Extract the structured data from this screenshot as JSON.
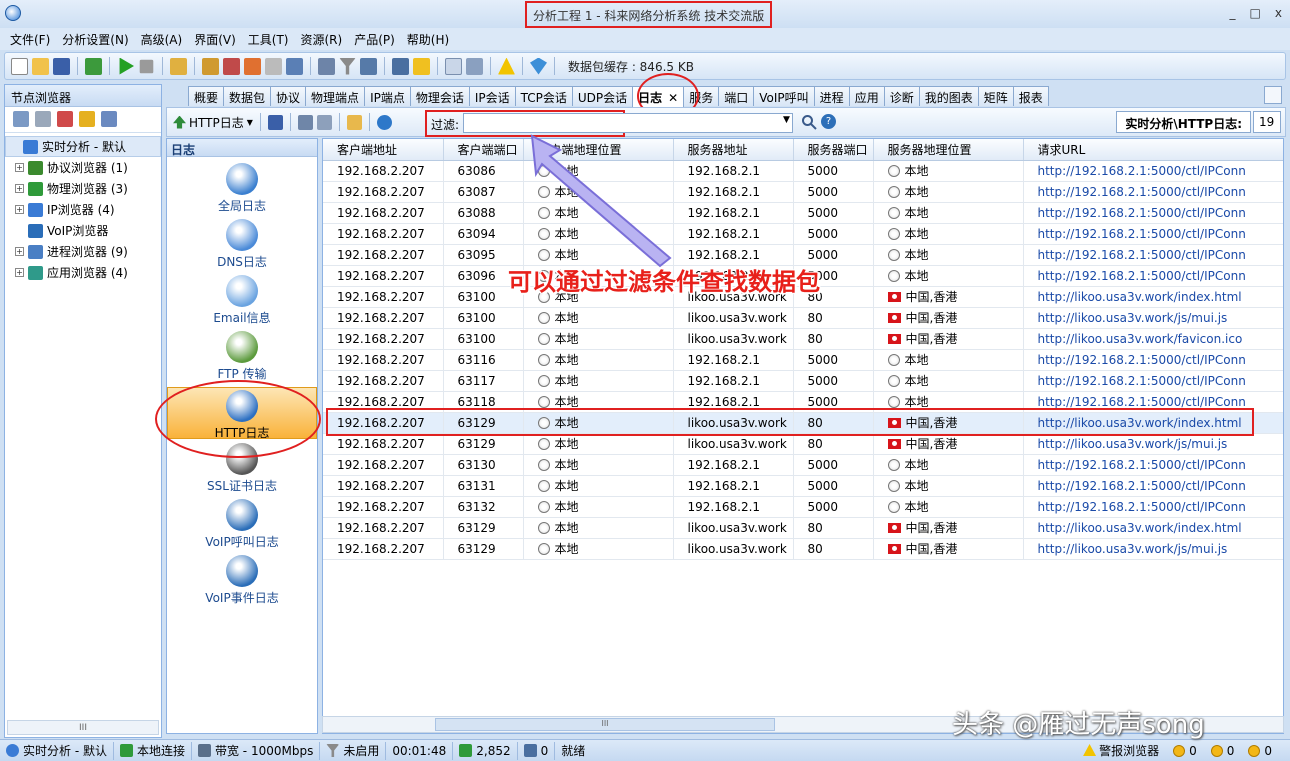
{
  "window": {
    "title": "分析工程 1 - 科来网络分析系统 技术交流版",
    "min": "_",
    "max": "□",
    "close": "x"
  },
  "menu": [
    "文件(F)",
    "分析设置(N)",
    "高级(A)",
    "界面(V)",
    "工具(T)",
    "资源(R)",
    "产品(P)",
    "帮助(H)"
  ],
  "toolbar": {
    "cache_label": "数据包缓存 : 846.5 KB"
  },
  "left_panel": {
    "title": "节点浏览器",
    "tree": [
      {
        "label": "实时分析 - 默认",
        "expander": "",
        "color": "#3a7bd5",
        "selected": true
      },
      {
        "label": "协议浏览器 (1)",
        "expander": "+",
        "color": "#3b8a2e"
      },
      {
        "label": "物理浏览器 (3)",
        "expander": "+",
        "color": "#2f9a3a"
      },
      {
        "label": "IP浏览器 (4)",
        "expander": "+",
        "color": "#3a7bd5"
      },
      {
        "label": "VoIP浏览器",
        "expander": "",
        "color": "#2a6db8"
      },
      {
        "label": "进程浏览器 (9)",
        "expander": "+",
        "color": "#4a7fc4"
      },
      {
        "label": "应用浏览器 (4)",
        "expander": "+",
        "color": "#2f9a8a"
      }
    ],
    "scroll_grip": "III"
  },
  "tabs": [
    "概要",
    "数据包",
    "协议",
    "物理端点",
    "IP端点",
    "物理会话",
    "IP会话",
    "TCP会话",
    "UDP会话",
    "日志",
    "服务",
    "端口",
    "VoIP呼叫",
    "进程",
    "应用",
    "诊断",
    "我的图表",
    "矩阵",
    "报表"
  ],
  "active_tab": "日志",
  "tab_close": "✕",
  "subbar": {
    "log_type": "HTTP日志",
    "filter_label": "过滤:",
    "filter_value": "",
    "breadcrumb": "实时分析\\HTTP日志:",
    "count": "19"
  },
  "log_panel": {
    "title": "日志",
    "items": [
      {
        "label": "全局日志",
        "color": "#3a7fcf"
      },
      {
        "label": "DNS日志",
        "color": "#4a8ad8"
      },
      {
        "label": "Email信息",
        "color": "#6aa3e0"
      },
      {
        "label": "FTP 传输",
        "color": "#5b9a3c"
      },
      {
        "label": "HTTP日志",
        "color": "#2c6fc2",
        "selected": true
      },
      {
        "label": "SSL证书日志",
        "color": "#555555"
      },
      {
        "label": "VoIP呼叫日志",
        "color": "#2a6db8"
      },
      {
        "label": "VoIP事件日志",
        "color": "#2a6db8"
      }
    ]
  },
  "grid": {
    "columns": [
      "客户端地址",
      "客户端端口",
      "客户端地理位置",
      "服务器地址",
      "服务器端口",
      "服务器地理位置",
      "请求URL"
    ],
    "rows": [
      [
        "192.168.2.207",
        "63086",
        "本地",
        "192.168.2.1",
        "5000",
        "本地",
        "http://192.168.2.1:5000/ctl/IPConn"
      ],
      [
        "192.168.2.207",
        "63087",
        "本地",
        "192.168.2.1",
        "5000",
        "本地",
        "http://192.168.2.1:5000/ctl/IPConn"
      ],
      [
        "192.168.2.207",
        "63088",
        "本地",
        "192.168.2.1",
        "5000",
        "本地",
        "http://192.168.2.1:5000/ctl/IPConn"
      ],
      [
        "192.168.2.207",
        "63094",
        "本地",
        "192.168.2.1",
        "5000",
        "本地",
        "http://192.168.2.1:5000/ctl/IPConn"
      ],
      [
        "192.168.2.207",
        "63095",
        "本地",
        "192.168.2.1",
        "5000",
        "本地",
        "http://192.168.2.1:5000/ctl/IPConn"
      ],
      [
        "192.168.2.207",
        "63096",
        "本地",
        "192.168.2.1",
        "5000",
        "本地",
        "http://192.168.2.1:5000/ctl/IPConn"
      ],
      [
        "192.168.2.207",
        "63100",
        "本地",
        "likoo.usa3v.work",
        "80",
        "中国,香港",
        "http://likoo.usa3v.work/index.html"
      ],
      [
        "192.168.2.207",
        "63100",
        "本地",
        "likoo.usa3v.work",
        "80",
        "中国,香港",
        "http://likoo.usa3v.work/js/mui.js"
      ],
      [
        "192.168.2.207",
        "63100",
        "本地",
        "likoo.usa3v.work",
        "80",
        "中国,香港",
        "http://likoo.usa3v.work/favicon.ico"
      ],
      [
        "192.168.2.207",
        "63116",
        "本地",
        "192.168.2.1",
        "5000",
        "本地",
        "http://192.168.2.1:5000/ctl/IPConn"
      ],
      [
        "192.168.2.207",
        "63117",
        "本地",
        "192.168.2.1",
        "5000",
        "本地",
        "http://192.168.2.1:5000/ctl/IPConn"
      ],
      [
        "192.168.2.207",
        "63118",
        "本地",
        "192.168.2.1",
        "5000",
        "本地",
        "http://192.168.2.1:5000/ctl/IPConn"
      ],
      [
        "192.168.2.207",
        "63129",
        "本地",
        "likoo.usa3v.work",
        "80",
        "中国,香港",
        "http://likoo.usa3v.work/index.html"
      ],
      [
        "192.168.2.207",
        "63129",
        "本地",
        "likoo.usa3v.work",
        "80",
        "中国,香港",
        "http://likoo.usa3v.work/js/mui.js"
      ],
      [
        "192.168.2.207",
        "63130",
        "本地",
        "192.168.2.1",
        "5000",
        "本地",
        "http://192.168.2.1:5000/ctl/IPConn"
      ],
      [
        "192.168.2.207",
        "63131",
        "本地",
        "192.168.2.1",
        "5000",
        "本地",
        "http://192.168.2.1:5000/ctl/IPConn"
      ],
      [
        "192.168.2.207",
        "63132",
        "本地",
        "192.168.2.1",
        "5000",
        "本地",
        "http://192.168.2.1:5000/ctl/IPConn"
      ],
      [
        "192.168.2.207",
        "63129",
        "本地",
        "likoo.usa3v.work",
        "80",
        "中国,香港",
        "http://likoo.usa3v.work/index.html"
      ],
      [
        "192.168.2.207",
        "63129",
        "本地",
        "likoo.usa3v.work",
        "80",
        "中国,香港",
        "http://likoo.usa3v.work/js/mui.js"
      ]
    ],
    "highlighted_row": 12,
    "scroll_grip": "III"
  },
  "annotation": "可以通过过滤条件查找数据包",
  "statusbar": {
    "mode": "实时分析 - 默认",
    "connection": "本地连接",
    "bandwidth": "带宽 - 1000Mbps",
    "filter": "未启用",
    "elapsed": "00:01:48",
    "packets": "2,852",
    "alerts": "0",
    "state": "就绪",
    "alarm_browser": "警报浏览器",
    "c1": "0",
    "c2": "0",
    "c3": "0"
  },
  "watermark": "头条 @雁过无声song"
}
